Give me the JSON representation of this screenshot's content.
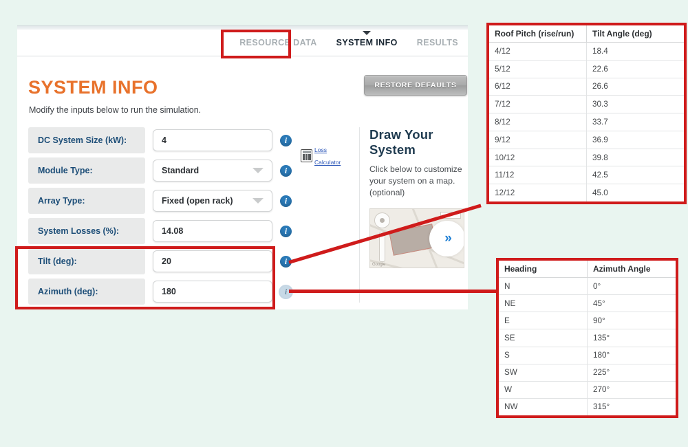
{
  "page": {
    "background_color": "#e9f5f0",
    "annotation_color": "#cf1b1b"
  },
  "tabs": [
    {
      "label": "RESOURCE DATA",
      "active": false
    },
    {
      "label": "SYSTEM INFO",
      "active": true
    },
    {
      "label": "RESULTS",
      "active": false
    }
  ],
  "header": {
    "title": "SYSTEM INFO",
    "subtitle": "Modify the inputs below to run the simulation.",
    "title_color": "#e8722c",
    "restore_defaults_label": "RESTORE DEFAULTS"
  },
  "form": {
    "rows": [
      {
        "label": "DC System Size (kW):",
        "value": "4",
        "type": "text",
        "info": "info-icon"
      },
      {
        "label": "Module Type:",
        "value": "Standard",
        "type": "select",
        "info": "info-icon"
      },
      {
        "label": "Array Type:",
        "value": "Fixed (open rack)",
        "type": "select",
        "info": "info-icon"
      },
      {
        "label": "System Losses (%):",
        "value": "14.08",
        "type": "text",
        "info": "info-icon"
      },
      {
        "label": "Tilt (deg):",
        "value": "20",
        "type": "text",
        "info": "info-icon"
      },
      {
        "label": "Azimuth (deg):",
        "value": "180",
        "type": "text",
        "info": "info-icon-highlighted"
      }
    ],
    "loss_calculator": {
      "line1": "Loss",
      "line2": "Calculator",
      "icon": "calculator-icon"
    }
  },
  "draw_system": {
    "title": "Draw Your System",
    "description": "Click below to customize your system on a map. (optional)",
    "map_credit": "Google",
    "next_arrow": "»"
  },
  "tables": {
    "roof_pitch": {
      "headers": [
        "Roof Pitch (rise/run)",
        "Tilt Angle (deg)"
      ],
      "rows": [
        [
          "4/12",
          "18.4"
        ],
        [
          "5/12",
          "22.6"
        ],
        [
          "6/12",
          "26.6"
        ],
        [
          "7/12",
          "30.3"
        ],
        [
          "8/12",
          "33.7"
        ],
        [
          "9/12",
          "36.9"
        ],
        [
          "10/12",
          "39.8"
        ],
        [
          "11/12",
          "42.5"
        ],
        [
          "12/12",
          "45.0"
        ]
      ]
    },
    "azimuth": {
      "headers": [
        "Heading",
        "Azimuth Angle"
      ],
      "rows": [
        [
          "N",
          "0°"
        ],
        [
          "NE",
          "45°"
        ],
        [
          "E",
          "90°"
        ],
        [
          "SE",
          "135°"
        ],
        [
          "S",
          "180°"
        ],
        [
          "SW",
          "225°"
        ],
        [
          "W",
          "270°"
        ],
        [
          "NW",
          "315°"
        ]
      ]
    }
  }
}
